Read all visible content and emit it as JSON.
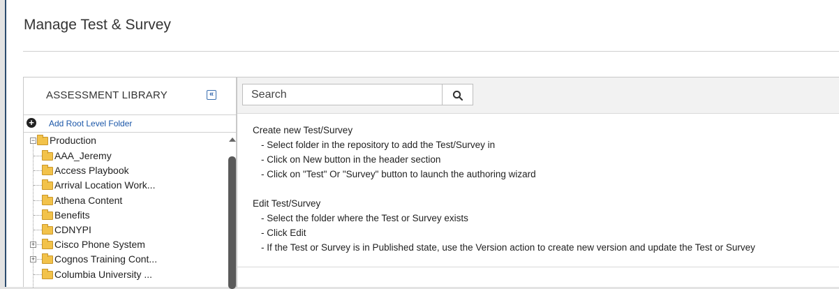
{
  "page": {
    "title": "Manage Test & Survey"
  },
  "library": {
    "title": "ASSESSMENT LIBRARY",
    "collapse_glyph": "«",
    "add_root_label": "Add Root Level Folder"
  },
  "tree": {
    "root": {
      "label": "Production",
      "expanded": true
    },
    "items": [
      {
        "label": "AAA_Jeremy",
        "expandable": false
      },
      {
        "label": "Access Playbook",
        "expandable": false
      },
      {
        "label": "Arrival Location Work...",
        "expandable": false
      },
      {
        "label": "Athena Content",
        "expandable": false
      },
      {
        "label": "Benefits",
        "expandable": false
      },
      {
        "label": "CDNYPI",
        "expandable": false
      },
      {
        "label": "Cisco Phone System",
        "expandable": true
      },
      {
        "label": "Cognos Training Cont...",
        "expandable": true
      },
      {
        "label": "Columbia University ...",
        "expandable": false
      }
    ]
  },
  "search": {
    "placeholder": "Search"
  },
  "instructions": [
    {
      "heading": "Create new Test/Survey",
      "steps": [
        "- Select folder in the repository to add the Test/Survey in",
        "- Click on New button in the header section",
        "- Click on \"Test\" Or \"Survey\" button to launch the authoring wizard"
      ]
    },
    {
      "heading": "Edit Test/Survey",
      "steps": [
        "- Select the folder where the Test or Survey exists",
        "- Click Edit",
        "- If the Test or Survey is in Published state, use the Version action to create new version and update the Test or Survey"
      ]
    }
  ],
  "colors": {
    "accent": "#1a56a8",
    "folder": "#f2c24a",
    "frame_border": "#2c4c6e"
  }
}
